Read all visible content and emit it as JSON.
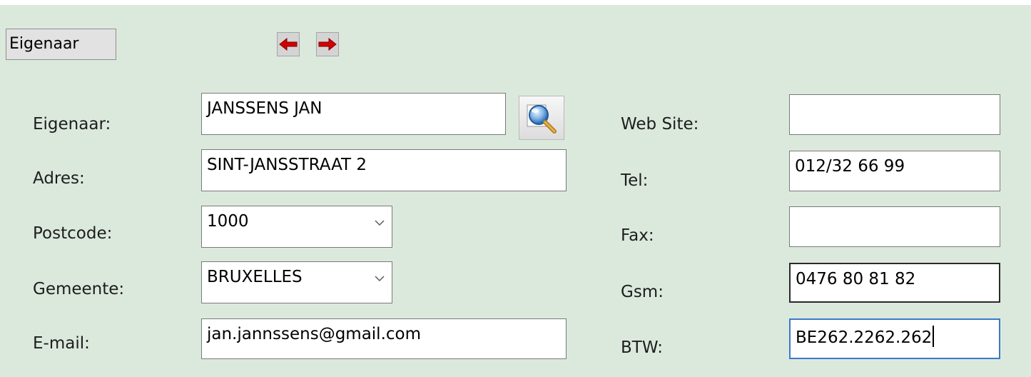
{
  "header": {
    "title": "Eigenaar"
  },
  "nav": {
    "prev_icon": "arrow-left-icon",
    "next_icon": "arrow-right-icon",
    "arrow_color": "#d40000"
  },
  "lookup": {
    "icon": "search-magnifier-icon"
  },
  "form": {
    "eigenaar": {
      "label": "Eigenaar:",
      "value": "JANSSENS JAN"
    },
    "adres": {
      "label": "Adres:",
      "value": "SINT-JANSSTRAAT 2"
    },
    "postcode": {
      "label": "Postcode:",
      "value": "1000"
    },
    "gemeente": {
      "label": "Gemeente:",
      "value": "BRUXELLES"
    },
    "email": {
      "label": "E-mail:",
      "value": "jan.jannssens@gmail.com"
    },
    "website": {
      "label": "Web Site:",
      "value": ""
    },
    "tel": {
      "label": "Tel:",
      "value": "012/32 66 99"
    },
    "fax": {
      "label": "Fax:",
      "value": ""
    },
    "gsm": {
      "label": "Gsm:",
      "value": "0476 80 81 82"
    },
    "btw": {
      "label": "BTW:",
      "value": "BE262.2262.262"
    }
  },
  "colors": {
    "panel_background": "#dbe9dd",
    "focus_border": "#3b79c8"
  }
}
